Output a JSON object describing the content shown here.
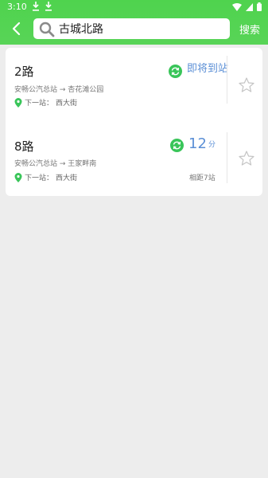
{
  "status_bar": {
    "time": "3:10"
  },
  "toolbar": {
    "search_value": "古城北路",
    "search_button": "搜索"
  },
  "routes": [
    {
      "name": "2路",
      "direction": "安畅公汽总站 → 杏花滩公园",
      "next_label": "下一站：",
      "next_stop": "西大街",
      "arrival_text": "即将到站"
    },
    {
      "name": "8路",
      "direction": "安畅公汽总站 → 王家畔南",
      "next_label": "下一站：",
      "next_stop": "西大街",
      "arrival_minutes": "12",
      "arrival_unit": "分",
      "distance": "相距7站"
    }
  ],
  "colors": {
    "header_green": "#58d457",
    "accent_blue": "#5b8fd6",
    "icon_green": "#39c559"
  }
}
